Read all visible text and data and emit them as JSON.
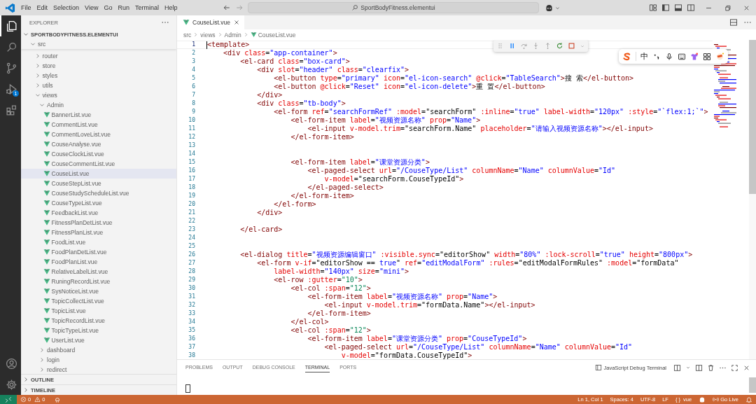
{
  "title_bar": {
    "menus": [
      "File",
      "Edit",
      "Selection",
      "View",
      "Go",
      "Run",
      "Terminal",
      "Help"
    ],
    "command_center": "SportBodyFitness.elementui"
  },
  "activity_bar": {
    "items": [
      {
        "kind": "explorer",
        "selected": true
      },
      {
        "kind": "search",
        "selected": false
      },
      {
        "kind": "source-control",
        "selected": false
      },
      {
        "kind": "run-debug",
        "selected": false,
        "badge": "1"
      },
      {
        "kind": "extensions",
        "selected": false
      }
    ],
    "bottom": [
      {
        "kind": "account"
      },
      {
        "kind": "settings"
      }
    ]
  },
  "sidebar": {
    "title": "EXPLORER",
    "workspace": {
      "name": "SPORTBODYFITNESS.ELEMENTUI",
      "expanded": true
    },
    "tree": [
      {
        "label": "src",
        "kind": "folder",
        "expanded": true,
        "selected": false,
        "children": [
          {
            "label": "router",
            "kind": "folder",
            "expanded": false,
            "selected": false
          },
          {
            "label": "store",
            "kind": "folder",
            "expanded": false,
            "selected": false
          },
          {
            "label": "styles",
            "kind": "folder",
            "expanded": false,
            "selected": false
          },
          {
            "label": "utils",
            "kind": "folder",
            "expanded": false,
            "selected": false
          },
          {
            "label": "views",
            "kind": "folder",
            "expanded": true,
            "selected": false,
            "children": [
              {
                "label": "Admin",
                "kind": "folder",
                "expanded": true,
                "selected": false,
                "children": [
                  {
                    "label": "BannerList.vue",
                    "kind": "file",
                    "selected": false
                  },
                  {
                    "label": "CommentList.vue",
                    "kind": "file",
                    "selected": false
                  },
                  {
                    "label": "CommentLoveList.vue",
                    "kind": "file",
                    "selected": false
                  },
                  {
                    "label": "CouseAnalyse.vue",
                    "kind": "file",
                    "selected": false
                  },
                  {
                    "label": "CouseClockList.vue",
                    "kind": "file",
                    "selected": false
                  },
                  {
                    "label": "CouseCommentList.vue",
                    "kind": "file",
                    "selected": false
                  },
                  {
                    "label": "CouseList.vue",
                    "kind": "file",
                    "selected": true
                  },
                  {
                    "label": "CouseStepList.vue",
                    "kind": "file",
                    "selected": false
                  },
                  {
                    "label": "CouseStudyScheduleList.vue",
                    "kind": "file",
                    "selected": false
                  },
                  {
                    "label": "CouseTypeList.vue",
                    "kind": "file",
                    "selected": false
                  },
                  {
                    "label": "FeedbackList.vue",
                    "kind": "file",
                    "selected": false
                  },
                  {
                    "label": "FitnessPlanDetList.vue",
                    "kind": "file",
                    "selected": false
                  },
                  {
                    "label": "FitnessPlanList.vue",
                    "kind": "file",
                    "selected": false
                  },
                  {
                    "label": "FoodList.vue",
                    "kind": "file",
                    "selected": false
                  },
                  {
                    "label": "FoodPlanDetList.vue",
                    "kind": "file",
                    "selected": false
                  },
                  {
                    "label": "FoodPlanList.vue",
                    "kind": "file",
                    "selected": false
                  },
                  {
                    "label": "RelativeLabelList.vue",
                    "kind": "file",
                    "selected": false
                  },
                  {
                    "label": "RuningRecordList.vue",
                    "kind": "file",
                    "selected": false
                  },
                  {
                    "label": "SysNoticeList.vue",
                    "kind": "file",
                    "selected": false
                  },
                  {
                    "label": "TopicCollectList.vue",
                    "kind": "file",
                    "selected": false
                  },
                  {
                    "label": "TopicList.vue",
                    "kind": "file",
                    "selected": false
                  },
                  {
                    "label": "TopicRecordList.vue",
                    "kind": "file",
                    "selected": false
                  },
                  {
                    "label": "TopicTypeList.vue",
                    "kind": "file",
                    "selected": false
                  },
                  {
                    "label": "UserList.vue",
                    "kind": "file",
                    "selected": false
                  }
                ]
              },
              {
                "label": "dashboard",
                "kind": "folder",
                "expanded": false,
                "selected": false
              },
              {
                "label": "login",
                "kind": "folder",
                "expanded": false,
                "selected": false
              },
              {
                "label": "redirect",
                "kind": "folder",
                "expanded": false,
                "selected": false
              }
            ]
          }
        ]
      }
    ],
    "sections": [
      {
        "label": "OUTLINE",
        "expanded": false
      },
      {
        "label": "TIMELINE",
        "expanded": false
      }
    ]
  },
  "editor": {
    "tabs": [
      {
        "label": "CouseList.vue",
        "selected": true
      }
    ],
    "breadcrumbs": [
      "src",
      "views",
      "Admin",
      "CouseList.vue"
    ],
    "lines": [
      {
        "number": "1",
        "current": true,
        "tokens": [
          {
            "kind": "tag",
            "text": "<template>"
          }
        ]
      },
      {
        "number": "2",
        "current": false,
        "tokens": [
          {
            "kind": "tag",
            "text": "    <div"
          },
          {
            "kind": "attr",
            "text": " class"
          },
          {
            "kind": "plain",
            "text": "="
          },
          {
            "kind": "str",
            "text": "\"app-container\""
          },
          {
            "kind": "tag",
            "text": ">"
          }
        ]
      },
      {
        "number": "3",
        "current": false,
        "tokens": [
          {
            "kind": "tag",
            "text": "        <el-card"
          },
          {
            "kind": "attr",
            "text": " class"
          },
          {
            "kind": "plain",
            "text": "="
          },
          {
            "kind": "str",
            "text": "\"box-card\""
          },
          {
            "kind": "tag",
            "text": ">"
          }
        ]
      },
      {
        "number": "4",
        "current": false,
        "tokens": [
          {
            "kind": "tag",
            "text": "            <div"
          },
          {
            "kind": "attr",
            "text": " slot"
          },
          {
            "kind": "plain",
            "text": "="
          },
          {
            "kind": "str",
            "text": "\"header\""
          },
          {
            "kind": "attr",
            "text": " class"
          },
          {
            "kind": "plain",
            "text": "="
          },
          {
            "kind": "str",
            "text": "\"clearfix\""
          },
          {
            "kind": "tag",
            "text": ">"
          }
        ]
      },
      {
        "number": "5",
        "current": false,
        "tokens": [
          {
            "kind": "tag",
            "text": "                <el-button"
          },
          {
            "kind": "attr",
            "text": " type"
          },
          {
            "kind": "plain",
            "text": "="
          },
          {
            "kind": "str",
            "text": "\"primary\""
          },
          {
            "kind": "attr",
            "text": " icon"
          },
          {
            "kind": "plain",
            "text": "="
          },
          {
            "kind": "str",
            "text": "\"el-icon-search\""
          },
          {
            "kind": "attr",
            "text": " @click"
          },
          {
            "kind": "plain",
            "text": "="
          },
          {
            "kind": "str",
            "text": "\"TableSearch\""
          },
          {
            "kind": "tag",
            "text": ">"
          },
          {
            "kind": "plain",
            "text": "搜 索"
          },
          {
            "kind": "tag",
            "text": "</el-button>"
          }
        ]
      },
      {
        "number": "6",
        "current": false,
        "tokens": [
          {
            "kind": "tag",
            "text": "                <el-button"
          },
          {
            "kind": "attr",
            "text": " @click"
          },
          {
            "kind": "plain",
            "text": "="
          },
          {
            "kind": "str",
            "text": "\"Reset\""
          },
          {
            "kind": "attr",
            "text": " icon"
          },
          {
            "kind": "plain",
            "text": "="
          },
          {
            "kind": "str",
            "text": "\"el-icon-delete\""
          },
          {
            "kind": "tag",
            "text": ">"
          },
          {
            "kind": "plain",
            "text": "重 置"
          },
          {
            "kind": "tag",
            "text": "</el-button>"
          }
        ]
      },
      {
        "number": "7",
        "current": false,
        "tokens": [
          {
            "kind": "tag",
            "text": "            </div>"
          }
        ]
      },
      {
        "number": "8",
        "current": false,
        "tokens": [
          {
            "kind": "tag",
            "text": "            <div"
          },
          {
            "kind": "attr",
            "text": " class"
          },
          {
            "kind": "plain",
            "text": "="
          },
          {
            "kind": "str",
            "text": "\"tb-body\""
          },
          {
            "kind": "tag",
            "text": ">"
          }
        ]
      },
      {
        "number": "9",
        "current": false,
        "tokens": [
          {
            "kind": "tag",
            "text": "                <el-form"
          },
          {
            "kind": "attr",
            "text": " ref"
          },
          {
            "kind": "plain",
            "text": "="
          },
          {
            "kind": "str",
            "text": "\"searchFormRef\""
          },
          {
            "kind": "attr",
            "text": " :model"
          },
          {
            "kind": "plain",
            "text": "="
          },
          {
            "kind": "plain",
            "text": "\"searchForm\""
          },
          {
            "kind": "attr",
            "text": " :inline"
          },
          {
            "kind": "plain",
            "text": "="
          },
          {
            "kind": "str",
            "text": "\"true\""
          },
          {
            "kind": "attr",
            "text": " label-width"
          },
          {
            "kind": "plain",
            "text": "="
          },
          {
            "kind": "str",
            "text": "\"120px\""
          },
          {
            "kind": "attr",
            "text": " :style"
          },
          {
            "kind": "plain",
            "text": "="
          },
          {
            "kind": "str",
            "text": "\"`flex:1;`\""
          },
          {
            "kind": "tag",
            "text": ">"
          }
        ]
      },
      {
        "number": "10",
        "current": false,
        "tokens": [
          {
            "kind": "tag",
            "text": "                    <el-form-item"
          },
          {
            "kind": "attr",
            "text": " label"
          },
          {
            "kind": "plain",
            "text": "="
          },
          {
            "kind": "str",
            "text": "\"视频资源名称\""
          },
          {
            "kind": "attr",
            "text": " prop"
          },
          {
            "kind": "plain",
            "text": "="
          },
          {
            "kind": "str",
            "text": "\"Name\""
          },
          {
            "kind": "tag",
            "text": ">"
          }
        ]
      },
      {
        "number": "11",
        "current": false,
        "tokens": [
          {
            "kind": "tag",
            "text": "                        <el-input"
          },
          {
            "kind": "attr",
            "text": " v-model.trim"
          },
          {
            "kind": "plain",
            "text": "="
          },
          {
            "kind": "plain",
            "text": "\"searchForm.Name\""
          },
          {
            "kind": "attr",
            "text": " placeholder"
          },
          {
            "kind": "plain",
            "text": "="
          },
          {
            "kind": "str",
            "text": "\"请输入视频资源名称\""
          },
          {
            "kind": "tag",
            "text": "></el-input>"
          }
        ]
      },
      {
        "number": "12",
        "current": false,
        "tokens": [
          {
            "kind": "tag",
            "text": "                    </el-form-item>"
          }
        ]
      },
      {
        "number": "13",
        "current": false
      },
      {
        "number": "14",
        "current": false
      },
      {
        "number": "15",
        "current": false,
        "tokens": [
          {
            "kind": "tag",
            "text": "                    <el-form-item"
          },
          {
            "kind": "attr",
            "text": " label"
          },
          {
            "kind": "plain",
            "text": "="
          },
          {
            "kind": "str",
            "text": "\"课堂资源分类\""
          },
          {
            "kind": "tag",
            "text": ">"
          }
        ]
      },
      {
        "number": "16",
        "current": false,
        "tokens": [
          {
            "kind": "tag",
            "text": "                        <el-paged-select"
          },
          {
            "kind": "attr",
            "text": " url"
          },
          {
            "kind": "plain",
            "text": "="
          },
          {
            "kind": "str",
            "text": "\"/CouseType/List\""
          },
          {
            "kind": "attr",
            "text": " columnName"
          },
          {
            "kind": "plain",
            "text": "="
          },
          {
            "kind": "str",
            "text": "\"Name\""
          },
          {
            "kind": "attr",
            "text": " columnValue"
          },
          {
            "kind": "plain",
            "text": "="
          },
          {
            "kind": "str",
            "text": "\"Id\""
          }
        ]
      },
      {
        "number": "17",
        "current": false,
        "tokens": [
          {
            "kind": "attr",
            "text": "                            v-model"
          },
          {
            "kind": "plain",
            "text": "="
          },
          {
            "kind": "plain",
            "text": "\"searchForm.CouseTypeId\""
          },
          {
            "kind": "tag",
            "text": ">"
          }
        ]
      },
      {
        "number": "18",
        "current": false,
        "tokens": [
          {
            "kind": "tag",
            "text": "                        </el-paged-select>"
          }
        ]
      },
      {
        "number": "19",
        "current": false,
        "tokens": [
          {
            "kind": "tag",
            "text": "                    </el-form-item>"
          }
        ]
      },
      {
        "number": "20",
        "current": false,
        "tokens": [
          {
            "kind": "tag",
            "text": "                </el-form>"
          }
        ]
      },
      {
        "number": "21",
        "current": false,
        "tokens": [
          {
            "kind": "tag",
            "text": "            </div>"
          }
        ]
      },
      {
        "number": "22",
        "current": false
      },
      {
        "number": "23",
        "current": false,
        "tokens": [
          {
            "kind": "tag",
            "text": "        </el-card>"
          }
        ]
      },
      {
        "number": "24",
        "current": false
      },
      {
        "number": "25",
        "current": false
      },
      {
        "number": "26",
        "current": false,
        "tokens": [
          {
            "kind": "tag",
            "text": "        <el-dialog"
          },
          {
            "kind": "attr",
            "text": " title"
          },
          {
            "kind": "plain",
            "text": "="
          },
          {
            "kind": "str",
            "text": "\"视频资源编辑窗口\""
          },
          {
            "kind": "attr",
            "text": " :visible.sync"
          },
          {
            "kind": "plain",
            "text": "="
          },
          {
            "kind": "plain",
            "text": "\"editorShow\""
          },
          {
            "kind": "attr",
            "text": " width"
          },
          {
            "kind": "plain",
            "text": "="
          },
          {
            "kind": "str",
            "text": "\"80%\""
          },
          {
            "kind": "attr",
            "text": " :lock-scroll"
          },
          {
            "kind": "plain",
            "text": "="
          },
          {
            "kind": "str",
            "text": "\"true\""
          },
          {
            "kind": "attr",
            "text": " height"
          },
          {
            "kind": "plain",
            "text": "="
          },
          {
            "kind": "str",
            "text": "\"800px\""
          },
          {
            "kind": "tag",
            "text": ">"
          }
        ]
      },
      {
        "number": "27",
        "current": false,
        "tokens": [
          {
            "kind": "tag",
            "text": "            <el-form"
          },
          {
            "kind": "attr",
            "text": " v-if"
          },
          {
            "kind": "plain",
            "text": "="
          },
          {
            "kind": "plain",
            "text": "\"editorShow == "
          },
          {
            "kind": "str",
            "text": "true"
          },
          {
            "kind": "plain",
            "text": "\""
          },
          {
            "kind": "attr",
            "text": " ref"
          },
          {
            "kind": "plain",
            "text": "="
          },
          {
            "kind": "str",
            "text": "\"editModalForm\""
          },
          {
            "kind": "attr",
            "text": " :rules"
          },
          {
            "kind": "plain",
            "text": "="
          },
          {
            "kind": "plain",
            "text": "\"editModalFormRules\""
          },
          {
            "kind": "attr",
            "text": " :model"
          },
          {
            "kind": "plain",
            "text": "="
          },
          {
            "kind": "plain",
            "text": "\"formData\""
          }
        ]
      },
      {
        "number": "28",
        "current": false,
        "tokens": [
          {
            "kind": "attr",
            "text": "                label-width"
          },
          {
            "kind": "plain",
            "text": "="
          },
          {
            "kind": "str",
            "text": "\"140px\""
          },
          {
            "kind": "attr",
            "text": " size"
          },
          {
            "kind": "plain",
            "text": "="
          },
          {
            "kind": "str",
            "text": "\"mini\""
          },
          {
            "kind": "tag",
            "text": ">"
          }
        ]
      },
      {
        "number": "29",
        "current": false,
        "tokens": [
          {
            "kind": "tag",
            "text": "                <el-row"
          },
          {
            "kind": "attr",
            "text": " :gutter"
          },
          {
            "kind": "plain",
            "text": "="
          },
          {
            "kind": "num",
            "text": "\"10\""
          },
          {
            "kind": "tag",
            "text": ">"
          }
        ]
      },
      {
        "number": "30",
        "current": false,
        "tokens": [
          {
            "kind": "tag",
            "text": "                    <el-col"
          },
          {
            "kind": "attr",
            "text": " :span"
          },
          {
            "kind": "plain",
            "text": "="
          },
          {
            "kind": "num",
            "text": "\"12\""
          },
          {
            "kind": "tag",
            "text": ">"
          }
        ]
      },
      {
        "number": "31",
        "current": false,
        "tokens": [
          {
            "kind": "tag",
            "text": "                        <el-form-item"
          },
          {
            "kind": "attr",
            "text": " label"
          },
          {
            "kind": "plain",
            "text": "="
          },
          {
            "kind": "str",
            "text": "\"视频资源名称\""
          },
          {
            "kind": "attr",
            "text": " prop"
          },
          {
            "kind": "plain",
            "text": "="
          },
          {
            "kind": "str",
            "text": "\"Name\""
          },
          {
            "kind": "tag",
            "text": ">"
          }
        ]
      },
      {
        "number": "32",
        "current": false,
        "tokens": [
          {
            "kind": "tag",
            "text": "                            <el-input"
          },
          {
            "kind": "attr",
            "text": " v-model.trim"
          },
          {
            "kind": "plain",
            "text": "="
          },
          {
            "kind": "plain",
            "text": "\"formData.Name\""
          },
          {
            "kind": "tag",
            "text": "></el-input>"
          }
        ]
      },
      {
        "number": "33",
        "current": false,
        "tokens": [
          {
            "kind": "tag",
            "text": "                        </el-form-item>"
          }
        ]
      },
      {
        "number": "34",
        "current": false,
        "tokens": [
          {
            "kind": "tag",
            "text": "                    </el-col>"
          }
        ]
      },
      {
        "number": "35",
        "current": false,
        "tokens": [
          {
            "kind": "tag",
            "text": "                    <el-col"
          },
          {
            "kind": "attr",
            "text": " :span"
          },
          {
            "kind": "plain",
            "text": "="
          },
          {
            "kind": "num",
            "text": "\"12\""
          },
          {
            "kind": "tag",
            "text": ">"
          }
        ]
      },
      {
        "number": "36",
        "current": false,
        "tokens": [
          {
            "kind": "tag",
            "text": "                        <el-form-item"
          },
          {
            "kind": "attr",
            "text": " label"
          },
          {
            "kind": "plain",
            "text": "="
          },
          {
            "kind": "str",
            "text": "\"课堂资源分类\""
          },
          {
            "kind": "attr",
            "text": " prop"
          },
          {
            "kind": "plain",
            "text": "="
          },
          {
            "kind": "str",
            "text": "\"CouseTypeId\""
          },
          {
            "kind": "tag",
            "text": ">"
          }
        ]
      },
      {
        "number": "37",
        "current": false,
        "tokens": [
          {
            "kind": "tag",
            "text": "                            <el-paged-select"
          },
          {
            "kind": "attr",
            "text": " url"
          },
          {
            "kind": "plain",
            "text": "="
          },
          {
            "kind": "str",
            "text": "\"/CouseType/List\""
          },
          {
            "kind": "attr",
            "text": " columnName"
          },
          {
            "kind": "plain",
            "text": "="
          },
          {
            "kind": "str",
            "text": "\"Name\""
          },
          {
            "kind": "attr",
            "text": " columnValue"
          },
          {
            "kind": "plain",
            "text": "="
          },
          {
            "kind": "str",
            "text": "\"Id\""
          }
        ]
      },
      {
        "number": "38",
        "current": false,
        "tokens": [
          {
            "kind": "attr",
            "text": "                                v-model"
          },
          {
            "kind": "plain",
            "text": "="
          },
          {
            "kind": "plain",
            "text": "\"formData.CouseTypeId\""
          },
          {
            "kind": "tag",
            "text": ">"
          }
        ]
      }
    ]
  },
  "ime_toolbar": {
    "mode": "中"
  },
  "panel": {
    "tabs": [
      {
        "label": "PROBLEMS",
        "selected": false
      },
      {
        "label": "OUTPUT",
        "selected": false
      },
      {
        "label": "DEBUG CONSOLE",
        "selected": false
      },
      {
        "label": "TERMINAL",
        "selected": true
      },
      {
        "label": "PORTS",
        "selected": false
      }
    ],
    "terminal_name": "JavaScript Debug Terminal"
  },
  "status_bar": {
    "errors": "0",
    "warnings": "0",
    "position": "Ln 1, Col 1",
    "indentation": "Spaces: 4",
    "encoding": "UTF-8",
    "eol": "LF",
    "language_icon": "{ }",
    "language": "vue",
    "live": "Go Live"
  }
}
